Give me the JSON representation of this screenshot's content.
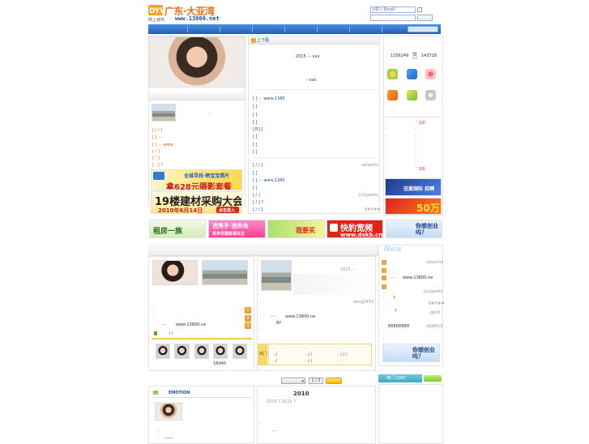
{
  "header": {
    "logo_main": "广东·大亚湾",
    "logo_sub": "网上城市",
    "logo_url": "www.13800.net",
    "logo_badge": "DYW",
    "login_user_placeholder": "UID / Email"
  },
  "left_col": {
    "top_photo_caption": "",
    "list1": [
      "[  ]  ···",
      "[  ]",
      "[  ]  ···        www.",
      "[  /  ]",
      "[  /  ]",
      "[  ·  ]  ?"
    ],
    "small_photo_caption": "··",
    "list1_first": "[  /  / ]"
  },
  "mid_col": {
    "header_label": "上下图",
    "line1": "2015      ···  xxx",
    "line2": "···xxx",
    "list_a": [
      "[  ]   ···          www.1380",
      "[  ]",
      "[  ]",
      "[  ]",
      "[日]  [",
      "[  ]",
      "[  ]",
      "[  ]"
    ],
    "list_b": [
      "[  /  / ]",
      "[  ]",
      "[  ]   ···          www.1380",
      "[  ]",
      "[  /  ]",
      "[  /  ]   ?",
      "[  /  / ]"
    ],
    "list_b_right": [
      "adsanha",
      "",
      "",
      "",
      "julygeeks",
      "",
      "9#H##"
    ]
  },
  "right_col": {
    "stat1": "1256249",
    "stat_sep": "0",
    "stat2": "143728",
    "list": [
      "·  ·",
      "·  ·",
      "·  ·",
      "·  ·",
      "·  ·",
      "·  ·",
      "·  ·",
      "·  ·"
    ],
    "list_right": [
      "' 10/",
      "",
      "",
      "",
      "",
      "",
      "",
      "' 10/"
    ]
  },
  "banners": {
    "b1_big": "拿628元摄影套餐",
    "b1_small": "全城寻找·晒宝宝照片",
    "b2_big": "19楼建材采购大会",
    "b2_date": "2010年6月14日",
    "b2_btn": "点击进入",
    "b3": "租房一族",
    "b4_top": "选秀手·迷你岛",
    "b4_bottom": "更多优惠敬请关注",
    "b5": "我要买",
    "b6_big": "快豹宽频",
    "b6_url": "www.dskb.cn",
    "b7_text": "你想创业吗？",
    "r_ad1": "迅爱国际 招聘",
    "r_ad2": "50万"
  },
  "lower": {
    "mid_user1": "dong2432",
    "mid_url": "www.13800.ne",
    "mid_by": "BY",
    "left_url": "www.13800.ne",
    "left_small": "i  /",
    "user_caption": "18d40",
    "yellow_tag": "热门",
    "right_new": "New",
    "right_list": [
      "adsanha",
      "www.13800.ne",
      "julygeeks",
      "?",
      "9#H##",
      "?",
      "ggzd",
      "ERERERER",
      "ddj8919"
    ],
    "mid_year": "2015  ···",
    "tab_label": "EMOTION",
    "year": "2010",
    "year_sub": "2015 T     2015     ?",
    "pager": "1 / 2",
    "teal_label": "热门   CJW?",
    "foot_line": "···"
  }
}
